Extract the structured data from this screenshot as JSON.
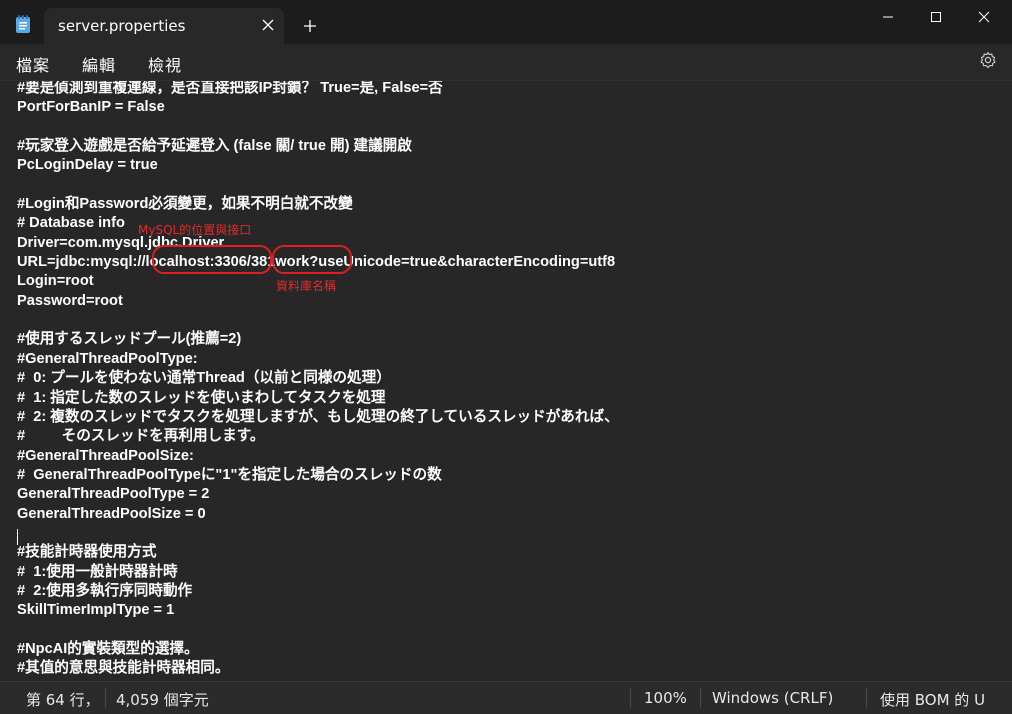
{
  "window": {
    "tab_title": "server.properties",
    "icons": {
      "app": "notepad-icon",
      "tab_close": "close-icon",
      "new_tab": "plus-icon",
      "minimize": "minimize-icon",
      "maximize": "maximize-icon",
      "close": "close-icon"
    }
  },
  "menu": {
    "file": "檔案",
    "edit": "編輯",
    "view": "檢視",
    "settings_icon": "gear-icon"
  },
  "editor": {
    "lines": [
      "#要是偵測到重複連線，是否直接把該IP封鎖？ True=是, False=否",
      "PortForBanIP = False",
      "",
      "#玩家登入遊戲是否給予延遲登入 (false 關/ true 開) 建議開啟",
      "PcLoginDelay = true",
      "",
      "#Login和Password必須變更，如果不明白就不改變",
      "# Database info",
      "Driver=com.mysql.jdbc.Driver",
      "URL=jdbc:mysql://localhost:3306/381work?useUnicode=true&characterEncoding=utf8",
      "Login=root",
      "Password=root",
      "",
      "#使用するスレッドプール(推薦=2)",
      "#GeneralThreadPoolType:",
      "#  0: プールを使わない通常Thread（以前と同様の処理）",
      "#  1: 指定した数のスレッドを使いまわしてタスクを処理",
      "#  2: 複数のスレッドでタスクを処理しますが、もし処理の終了しているスレッドがあれば、",
      "#         そのスレッドを再利用します。",
      "#GeneralThreadPoolSize:",
      "#  GeneralThreadPoolTypeに\"1\"を指定した場合のスレッドの数",
      "GeneralThreadPoolType = 2",
      "GeneralThreadPoolSize = 0",
      "",
      "#技能計時器使用方式",
      "#  1:使用一般計時器計時",
      "#  2:使用多執行序同時動作",
      "SkillTimerImplType = 1",
      "",
      "#NpcAI的實裝類型的選擇。",
      "#其值的意思與技能計時器相同。"
    ],
    "annotations": {
      "mysql_location": "MySQL的位置與接口",
      "database_name": "資料庫名稱",
      "color": "#e01e1e"
    }
  },
  "status": {
    "position": "第 64 行，",
    "chars": "4,059 個字元",
    "zoom": "100%",
    "line_ending": "Windows (CRLF)",
    "encoding": "使用 BOM 的 U"
  }
}
